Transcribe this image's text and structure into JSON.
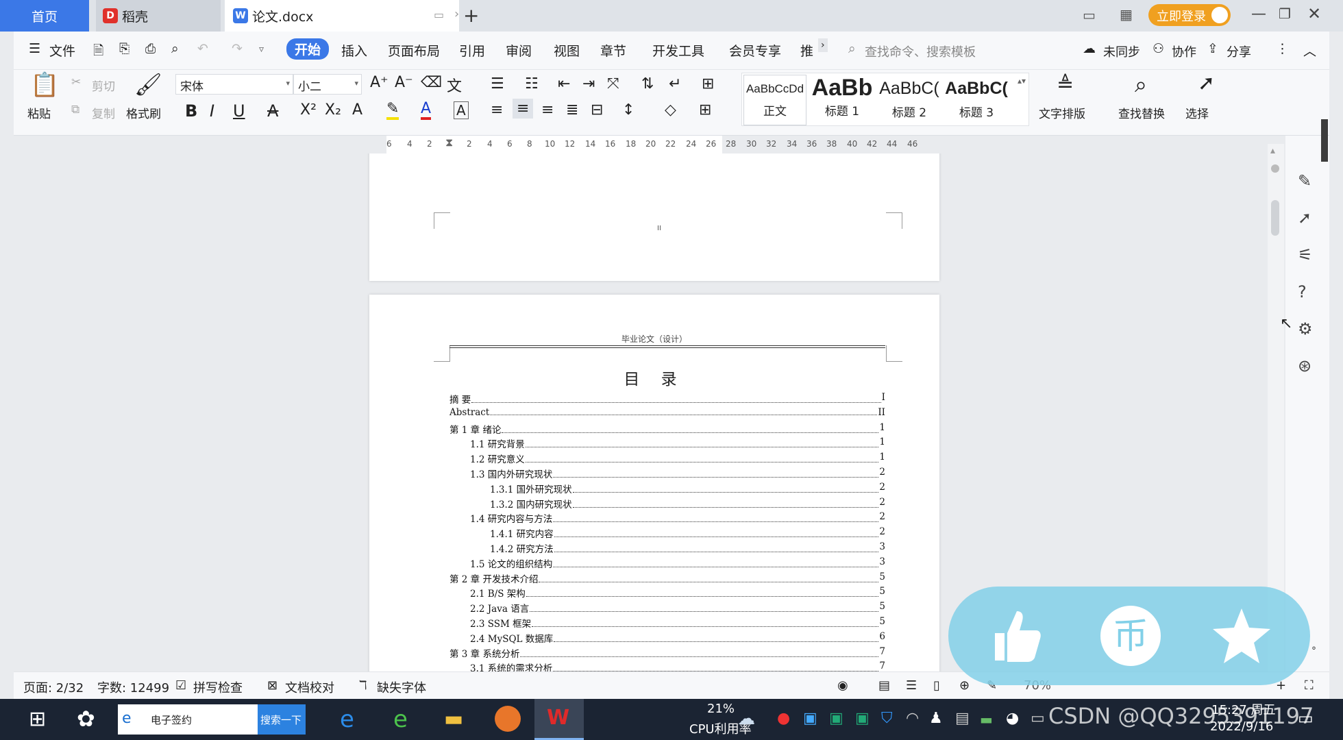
{
  "tabs": {
    "home": "首页",
    "daoke": "稻壳",
    "doc": "论文.docx",
    "add": "+"
  },
  "titlebar": {
    "login": "立即登录"
  },
  "menu": {
    "file": "文件",
    "items": [
      "开始",
      "插入",
      "页面布局",
      "引用",
      "审阅",
      "视图",
      "章节",
      "开发工具",
      "会员专享",
      "推"
    ],
    "search_placeholder": "查找命令、搜索模板",
    "sync": "未同步",
    "collab": "协作",
    "share": "分享"
  },
  "ribbon": {
    "paste": "粘贴",
    "cut": "剪切",
    "copy": "复制",
    "format_painter": "格式刷",
    "font_name": "宋体",
    "font_size": "小二",
    "styles": [
      {
        "preview": "AaBbCcDd",
        "name": "正文"
      },
      {
        "preview": "AaBb",
        "name": "标题 1"
      },
      {
        "preview": "AaBbC(",
        "name": "标题 2"
      },
      {
        "preview": "AaBbC(",
        "name": "标题 3"
      }
    ],
    "text_layout": "文字排版",
    "find_replace": "查找替换",
    "select": "选择"
  },
  "ruler": [
    "6",
    "4",
    "2",
    "2",
    "4",
    "6",
    "8",
    "10",
    "12",
    "14",
    "16",
    "18",
    "20",
    "22",
    "24",
    "26",
    "28",
    "30",
    "32",
    "34",
    "36",
    "38",
    "40",
    "42",
    "44",
    "46"
  ],
  "document": {
    "prev_page_mark": "II",
    "header": "毕业论文（设计）",
    "toc_title": "目  录",
    "toc": [
      {
        "level": 1,
        "text": "摘    要",
        "page": "I"
      },
      {
        "level": 1,
        "text": "Abstract",
        "page": "II"
      },
      {
        "level": 1,
        "text": "第 1 章  绪论",
        "page": "1"
      },
      {
        "level": 2,
        "text": "1.1 研究背景",
        "page": "1"
      },
      {
        "level": 2,
        "text": "1.2 研究意义",
        "page": "1"
      },
      {
        "level": 2,
        "text": "1.3 国内外研究现状",
        "page": "2"
      },
      {
        "level": 3,
        "text": "1.3.1 国外研究现状",
        "page": "2"
      },
      {
        "level": 3,
        "text": "1.3.2 国内研究现状",
        "page": "2"
      },
      {
        "level": 2,
        "text": "1.4 研究内容与方法",
        "page": "2"
      },
      {
        "level": 3,
        "text": "1.4.1 研究内容",
        "page": "2"
      },
      {
        "level": 3,
        "text": "1.4.2 研究方法",
        "page": "3"
      },
      {
        "level": 2,
        "text": "1.5 论文的组织结构",
        "page": "3"
      },
      {
        "level": 1,
        "text": "第 2 章  开发技术介绍",
        "page": "5"
      },
      {
        "level": 2,
        "text": "2.1 B/S 架构",
        "page": "5"
      },
      {
        "level": 2,
        "text": "2.2 Java 语言",
        "page": "5"
      },
      {
        "level": 2,
        "text": "2.3 SSM 框架",
        "page": "5"
      },
      {
        "level": 2,
        "text": "2.4 MySQL 数据库",
        "page": "6"
      },
      {
        "level": 1,
        "text": "第 3 章  系统分析",
        "page": "7"
      },
      {
        "level": 2,
        "text": "3.1 系统的需求分析",
        "page": "7"
      }
    ]
  },
  "status": {
    "page": "页面: 2/32",
    "words": "字数: 12499",
    "spell": "拼写检查",
    "proof": "文档校对",
    "missing_font": "缺失字体",
    "zoom": "70%"
  },
  "taskbar": {
    "search_text": "电子签约",
    "search_button": "搜索一下",
    "cpu_pct": "21%",
    "cpu_label": "CPU利用率",
    "time": "15:27 周五",
    "date": "2022/9/16",
    "watermark": "CSDN @QQ3295391197"
  },
  "colors": {
    "accent": "#3b78e7",
    "login": "#f0a020",
    "overlay": "#82d0e8",
    "taskbar": "#1b2433"
  }
}
